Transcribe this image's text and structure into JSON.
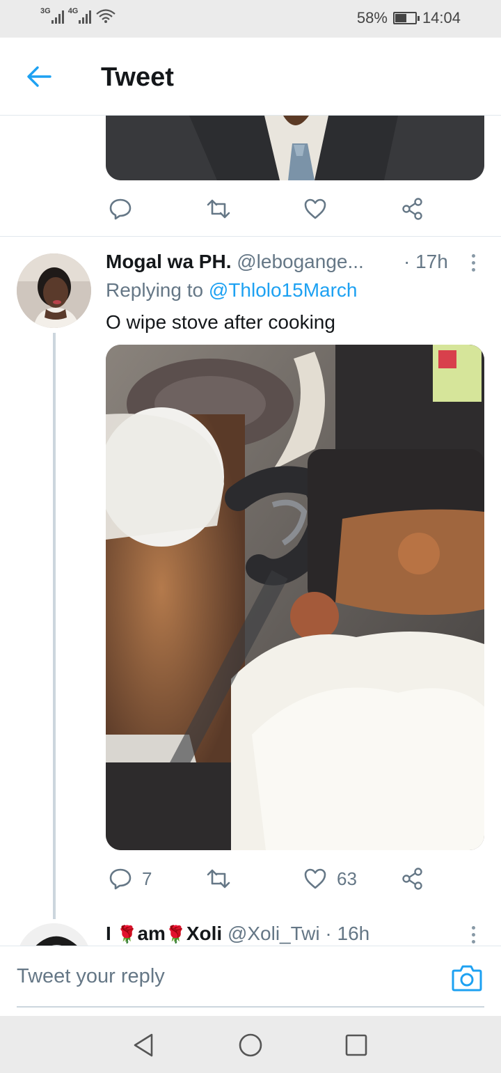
{
  "status_bar": {
    "network_1": "3G",
    "network_2": "4G",
    "battery_level": 0.58,
    "battery_text": "58%",
    "time": "14:04"
  },
  "header": {
    "title": "Tweet",
    "back_icon": "arrow-left-icon",
    "accent_color": "#1da1f2"
  },
  "previous_tweet": {
    "actions": [
      {
        "icon": "reply-icon",
        "count": ""
      },
      {
        "icon": "retweet-icon",
        "count": ""
      },
      {
        "icon": "like-icon",
        "count": ""
      },
      {
        "icon": "share-icon",
        "count": ""
      }
    ]
  },
  "reply_tweet": {
    "display_name": "Mogal wa PH.",
    "handle": "@lebogange...",
    "time": "· 17h",
    "replying_prefix": "Replying to",
    "replying_to": "@Thlolo15March",
    "text": "O wipe stove after cooking",
    "actions": [
      {
        "icon": "reply-icon",
        "count": "7"
      },
      {
        "icon": "retweet-icon",
        "count": ""
      },
      {
        "icon": "like-icon",
        "count": "63"
      },
      {
        "icon": "share-icon",
        "count": ""
      }
    ]
  },
  "next_tweet": {
    "name_part_1": "I",
    "rose_1": "🌹",
    "name_part_2": "am",
    "rose_2": "🌹",
    "name_part_3": "Xoli",
    "handle": "@Xoli_Twi",
    "time": "· 16h"
  },
  "reply_bar": {
    "placeholder": "Tweet your reply",
    "camera_icon": "camera-icon"
  },
  "nav_bar": {
    "back_icon": "nav-back-icon",
    "home_icon": "nav-home-icon",
    "recents_icon": "nav-recents-icon"
  }
}
